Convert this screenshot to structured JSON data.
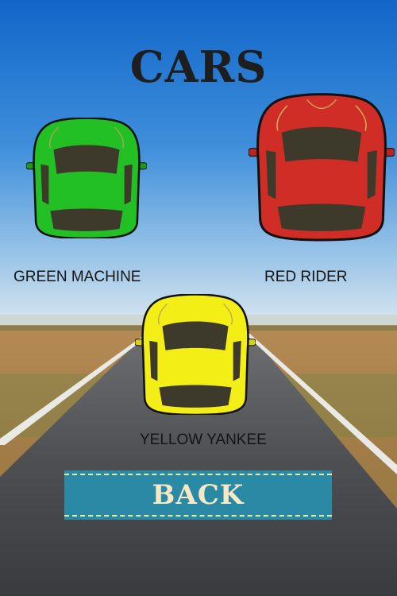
{
  "title": "CARS",
  "cars": [
    {
      "name": "GREEN MACHINE",
      "body_color": "#22c025",
      "icon": "green-car-icon"
    },
    {
      "name": "RED RIDER",
      "body_color": "#cf2d26",
      "icon": "red-car-icon"
    },
    {
      "name": "YELLOW YANKEE",
      "body_color": "#f4ee17",
      "icon": "yellow-car-icon"
    }
  ],
  "back_button": {
    "label": "BACK",
    "color": "#2a8aa5"
  }
}
